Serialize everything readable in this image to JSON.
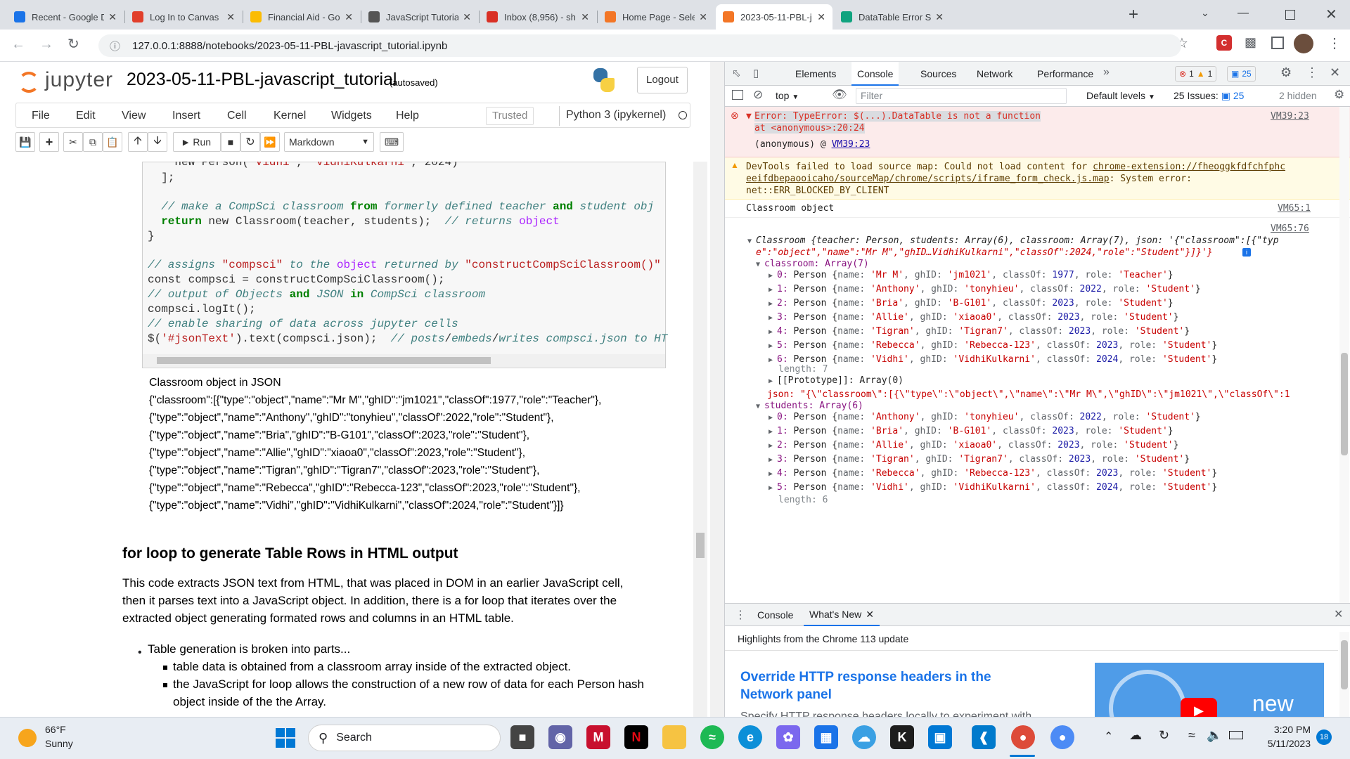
{
  "browser": {
    "tabs": [
      {
        "label": "Recent - Google D",
        "icon": "google-drive-icon",
        "color": "#1a73e8"
      },
      {
        "label": "Log In to Canvas",
        "icon": "canvas-icon",
        "color": "#e13f2b"
      },
      {
        "label": "Financial Aid - Go",
        "icon": "google-drive-icon",
        "color": "#fbbc04"
      },
      {
        "label": "JavaScript Tutoria",
        "icon": "javascript-icon",
        "color": "#555555"
      },
      {
        "label": "Inbox (8,956) - sh",
        "icon": "gmail-icon",
        "color": "#d93025"
      },
      {
        "label": "Home Page - Sele",
        "icon": "jupyter-icon",
        "color": "#f37626"
      },
      {
        "label": "2023-05-11-PBL-j",
        "icon": "jupyter-icon",
        "color": "#f37626"
      },
      {
        "label": "DataTable Error S",
        "icon": "chatgpt-icon",
        "color": "#10a37f"
      }
    ],
    "url": "127.0.0.1:8888/notebooks/2023-05-11-PBL-javascript_tutorial.ipynb"
  },
  "jupyter": {
    "logo_text": "jupyter",
    "notebook_title": "2023-05-11-PBL-javascript_tutorial",
    "autosave": "(autosaved)",
    "logout_label": "Logout",
    "menu": [
      "File",
      "Edit",
      "View",
      "Insert",
      "Cell",
      "Kernel",
      "Widgets",
      "Help"
    ],
    "trusted_label": "Trusted",
    "kernel_label": "Python 3 (ipykernel)",
    "run_label": "Run",
    "cell_type": "Markdown",
    "output_label": "Classroom object in JSON",
    "output_json": [
      "{\"classroom\":[{\"type\":\"object\",\"name\":\"Mr M\",\"ghID\":\"jm1021\",\"classOf\":1977,\"role\":\"Teacher\"},",
      "{\"type\":\"object\",\"name\":\"Anthony\",\"ghID\":\"tonyhieu\",\"classOf\":2022,\"role\":\"Student\"},",
      "{\"type\":\"object\",\"name\":\"Bria\",\"ghID\":\"B-G101\",\"classOf\":2023,\"role\":\"Student\"},",
      "{\"type\":\"object\",\"name\":\"Allie\",\"ghID\":\"xiaoa0\",\"classOf\":2023,\"role\":\"Student\"},",
      "{\"type\":\"object\",\"name\":\"Tigran\",\"ghID\":\"Tigran7\",\"classOf\":2023,\"role\":\"Student\"},",
      "{\"type\":\"object\",\"name\":\"Rebecca\",\"ghID\":\"Rebecca-123\",\"classOf\":2023,\"role\":\"Student\"},",
      "{\"type\":\"object\",\"name\":\"Vidhi\",\"ghID\":\"VidhiKulkarni\",\"classOf\":2024,\"role\":\"Student\"}]}"
    ],
    "heading": "for loop to generate Table Rows in HTML output",
    "paragraph": [
      "This code extracts JSON text from HTML, that was placed in DOM in an earlier JavaScript cell,",
      "then it parses text into a JavaScript object. In addition, there is a for loop that iterates over the",
      "extracted object generating formated rows and columns in an HTML table."
    ],
    "bullet_main": "Table generation is broken into parts...",
    "sub_bullets": [
      "table data is obtained from a classroom array inside of the extracted object.",
      "the JavaScript for loop allows the construction of a new row of data for each Person hash",
      "object inside of the the Array."
    ]
  },
  "devtools": {
    "tabs": [
      "Elements",
      "Console",
      "Sources",
      "Network",
      "Performance"
    ],
    "error_count": "1",
    "warn_count": "1",
    "msg_count": "25",
    "context": "top",
    "filter_placeholder": "Filter",
    "levels": "Default levels",
    "issues_label": "25 Issues:",
    "issues_count": "25",
    "hidden_label": "2 hidden",
    "error_line1": "Error: TypeError: $(...).DataTable is not a function",
    "error_line2": "    at <anonymous>:20:24",
    "error_src": "VM39:23",
    "error_anon": "(anonymous) @ ",
    "error_anon_link": "VM39:23",
    "warn_line1a": "DevTools failed to load source map: Could not load content for ",
    "warn_link1": "chrome-extension://fheoggkfdfchfphc",
    "warn_link2": "eeifdbepaooicaho/sourceMap/chrome/scripts/iframe_form_check.js.map",
    "warn_line2b": ": System error:",
    "warn_line3": "net::ERR_BLOCKED_BY_CLIENT",
    "log1": "Classroom object",
    "log1_src": "VM65:1",
    "log2_src": "VM65:76",
    "classroom_summary": "Classroom {teacher: Person, students: Array(6), classroom: Array(7), json: '{\"classroom\":[{\"typ",
    "classroom_summary2": "e\":\"object\",\"name\":\"Mr M\",\"ghID…VidhiKulkarni\",\"classOf\":2024,\"role\":\"Student\"}]}'}",
    "classroom_key": "classroom: Array(7)",
    "classroom_items": [
      {
        "i": "0",
        "name": "Mr M",
        "gh": "jm1021",
        "year": "1977",
        "role": "Teacher"
      },
      {
        "i": "1",
        "name": "Anthony",
        "gh": "tonyhieu",
        "year": "2022",
        "role": "Student"
      },
      {
        "i": "2",
        "name": "Bria",
        "gh": "B-G101",
        "year": "2023",
        "role": "Student"
      },
      {
        "i": "3",
        "name": "Allie",
        "gh": "xiaoa0",
        "year": "2023",
        "role": "Student"
      },
      {
        "i": "4",
        "name": "Tigran",
        "gh": "Tigran7",
        "year": "2023",
        "role": "Student"
      },
      {
        "i": "5",
        "name": "Rebecca",
        "gh": "Rebecca-123",
        "year": "2023",
        "role": "Student"
      },
      {
        "i": "6",
        "name": "Vidhi",
        "gh": "VidhiKulkarni",
        "year": "2024",
        "role": "Student"
      }
    ],
    "length7": "length: 7",
    "prototype": "[[Prototype]]: Array(0)",
    "json_line": "json: \"{\\\"classroom\\\":[{\\\"type\\\":\\\"object\\\",\\\"name\\\":\\\"Mr M\\\",\\\"ghID\\\":\\\"jm1021\\\",\\\"classOf\\\":1",
    "students_key": "students: Array(6)",
    "students_items": [
      {
        "i": "0",
        "name": "Anthony",
        "gh": "tonyhieu",
        "year": "2022",
        "role": "Student"
      },
      {
        "i": "1",
        "name": "Bria",
        "gh": "B-G101",
        "year": "2023",
        "role": "Student"
      },
      {
        "i": "2",
        "name": "Allie",
        "gh": "xiaoa0",
        "year": "2023",
        "role": "Student"
      },
      {
        "i": "3",
        "name": "Tigran",
        "gh": "Tigran7",
        "year": "2023",
        "role": "Student"
      },
      {
        "i": "4",
        "name": "Rebecca",
        "gh": "Rebecca-123",
        "year": "2023",
        "role": "Student"
      },
      {
        "i": "5",
        "name": "Vidhi",
        "gh": "VidhiKulkarni",
        "year": "2024",
        "role": "Student"
      }
    ],
    "length6": "length: 6",
    "drawer_tabs": [
      "Console",
      "What's New"
    ],
    "whatsnew_sub": "Highlights from the Chrome 113 update",
    "whatsnew_title": "Override HTTP response headers in the Network panel",
    "whatsnew_desc": "Specify HTTP response headers locally to experiment with different values.",
    "whatsnew_badge": "new"
  },
  "taskbar": {
    "weather_temp": "66°F",
    "weather_desc": "Sunny",
    "search_label": "Search",
    "time": "3:20 PM",
    "date": "5/11/2023",
    "notif_count": "18"
  }
}
